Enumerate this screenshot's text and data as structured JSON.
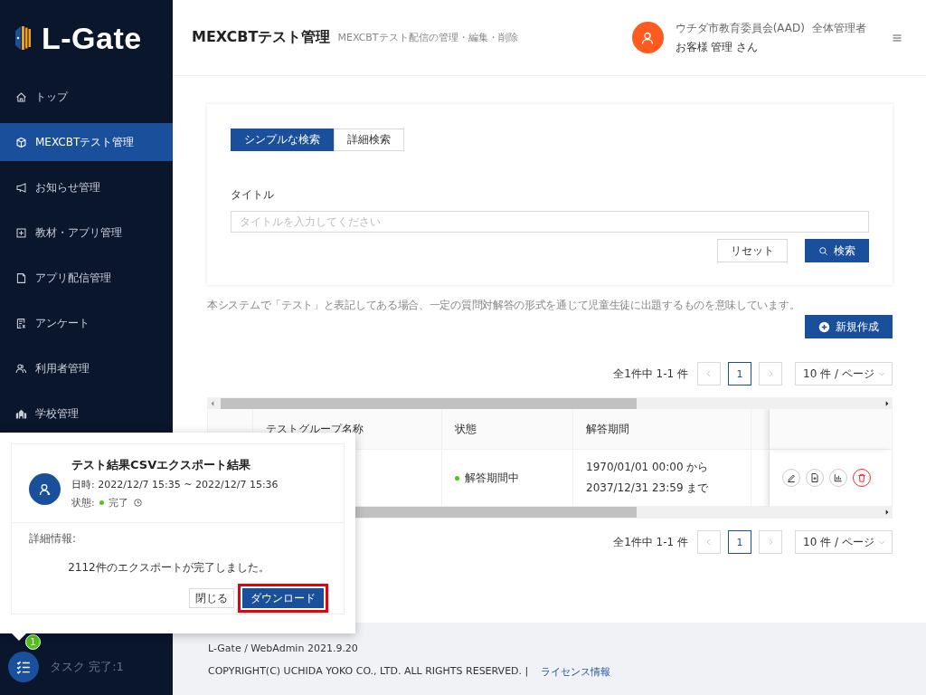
{
  "logo": {
    "text": "L-Gate"
  },
  "sidebar": {
    "items": [
      {
        "label": "トップ",
        "selected": false
      },
      {
        "label": "MEXCBTテスト管理",
        "selected": true
      },
      {
        "label": "お知らせ管理",
        "selected": false
      },
      {
        "label": "教材・アプリ管理",
        "selected": false
      },
      {
        "label": "アプリ配信管理",
        "selected": false
      },
      {
        "label": "アンケート",
        "selected": false
      },
      {
        "label": "利用者管理",
        "selected": false
      },
      {
        "label": "学校管理",
        "selected": false
      }
    ],
    "task": {
      "badge": "1",
      "label": "タスク 完了:1"
    }
  },
  "header": {
    "title": "MEXCBTテスト管理",
    "subtitle": "MEXCBTテスト配信の管理・編集・削除",
    "org": "ウチダ市教育委員会(AAD)",
    "role": "全体管理者",
    "user": "お客様 管理 さん"
  },
  "search": {
    "tabs": [
      {
        "label": "シンプルな検索",
        "selected": true
      },
      {
        "label": "詳細検索",
        "selected": false
      }
    ],
    "field_label": "タイトル",
    "placeholder": "タイトルを入力してください",
    "reset_button": "リセット",
    "search_button": "検索"
  },
  "notice": "本システムで「テスト」と表記してある場合、一定の質問対解答の形式を通じて児童生徒に出題するものを意味しています。",
  "new_button": "新規作成",
  "pagination_top": {
    "summary": "全1件中 1-1 件",
    "pages": [
      {
        "label": "1",
        "selected": true
      }
    ],
    "page_size": "10 件 / ページ"
  },
  "table": {
    "columns": [
      "テストグループ名称",
      "状態",
      "解答期間"
    ],
    "rows": [
      {
        "status": "解答期間中",
        "period_start": "1970/01/01 00:00 から",
        "period_end": "2037/12/31 23:59 まで"
      }
    ]
  },
  "pagination_bottom": {
    "summary": "全1件中 1-1 件",
    "pages": [
      {
        "label": "1",
        "selected": true
      }
    ],
    "page_size": "10 件 / ページ"
  },
  "popup": {
    "title": "テスト結果CSVエクスポート結果",
    "datetime": "日時: 2022/12/7 15:35 ~ 2022/12/7 15:36",
    "status_label": "状態:",
    "status": "完了",
    "detail_label": "詳細情報:",
    "message": "2112件のエクスポートが完了しました。",
    "close_button": "閉じる",
    "download_button": "ダウンロード",
    "download_highlighted": true
  },
  "footer": {
    "version": "L-Gate / WebAdmin 2021.9.20",
    "copyright": "COPYRIGHT(C) UCHIDA YOKO CO., LTD. ALL RIGHTS RESERVED. |",
    "link": "ライセンス情報"
  }
}
